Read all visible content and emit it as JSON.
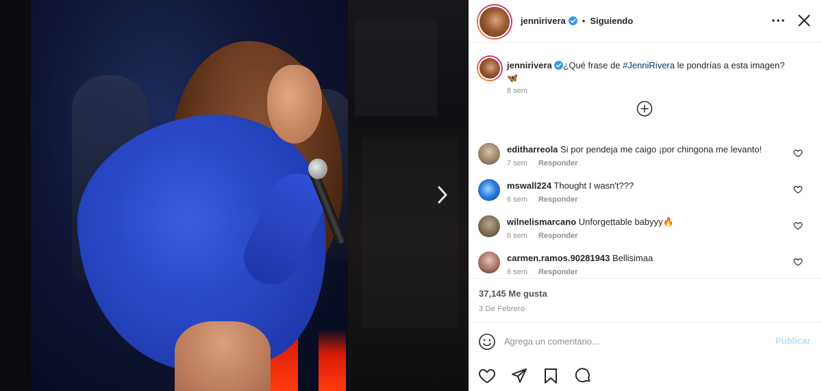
{
  "post": {
    "author": "jennirivera",
    "follow_status": "Siguiendo",
    "caption_before": "¿Qué frase de ",
    "caption_hashtag": "#JenniRivera",
    "caption_after": " le pondrías a esta imagen?",
    "caption_emoji": "🦋",
    "caption_time": "8 sem",
    "likes": "37,145 Me gusta",
    "date": "3 De Febrero"
  },
  "comments": [
    {
      "user": "editharreola",
      "text": "Si por pendeja me caigo ¡por chingona me levanto!",
      "time": "7 sem",
      "reply": "Responder"
    },
    {
      "user": "mswall224",
      "text": "Thought I wasn't???",
      "time": "6 sem",
      "reply": "Responder"
    },
    {
      "user": "wilnelismarcano",
      "text": "Unforgettable babyyy🔥",
      "time": "6 sem",
      "reply": "Responder"
    },
    {
      "user": "carmen.ramos.90281943",
      "text": "Bellisimaa",
      "time": "6 sem",
      "reply": "Responder"
    }
  ],
  "comment_box": {
    "placeholder": "Agrega un comentario...",
    "publish_label": "Publicar"
  },
  "icons": {
    "more": "more-options-icon",
    "close": "close-icon",
    "verified": "verified-badge-icon",
    "load_more": "plus-circle-icon",
    "like": "heart-icon",
    "comment": "comment-icon",
    "share": "share-icon",
    "save": "bookmark-icon",
    "emoji": "emoji-icon",
    "next": "chevron-right-icon"
  },
  "colors": {
    "verified": "#3897f0",
    "hashtag": "#00376b",
    "publish_disabled": "#b2dffc",
    "story_ring_start": "#f9a13a",
    "story_ring_end": "#c13584"
  }
}
